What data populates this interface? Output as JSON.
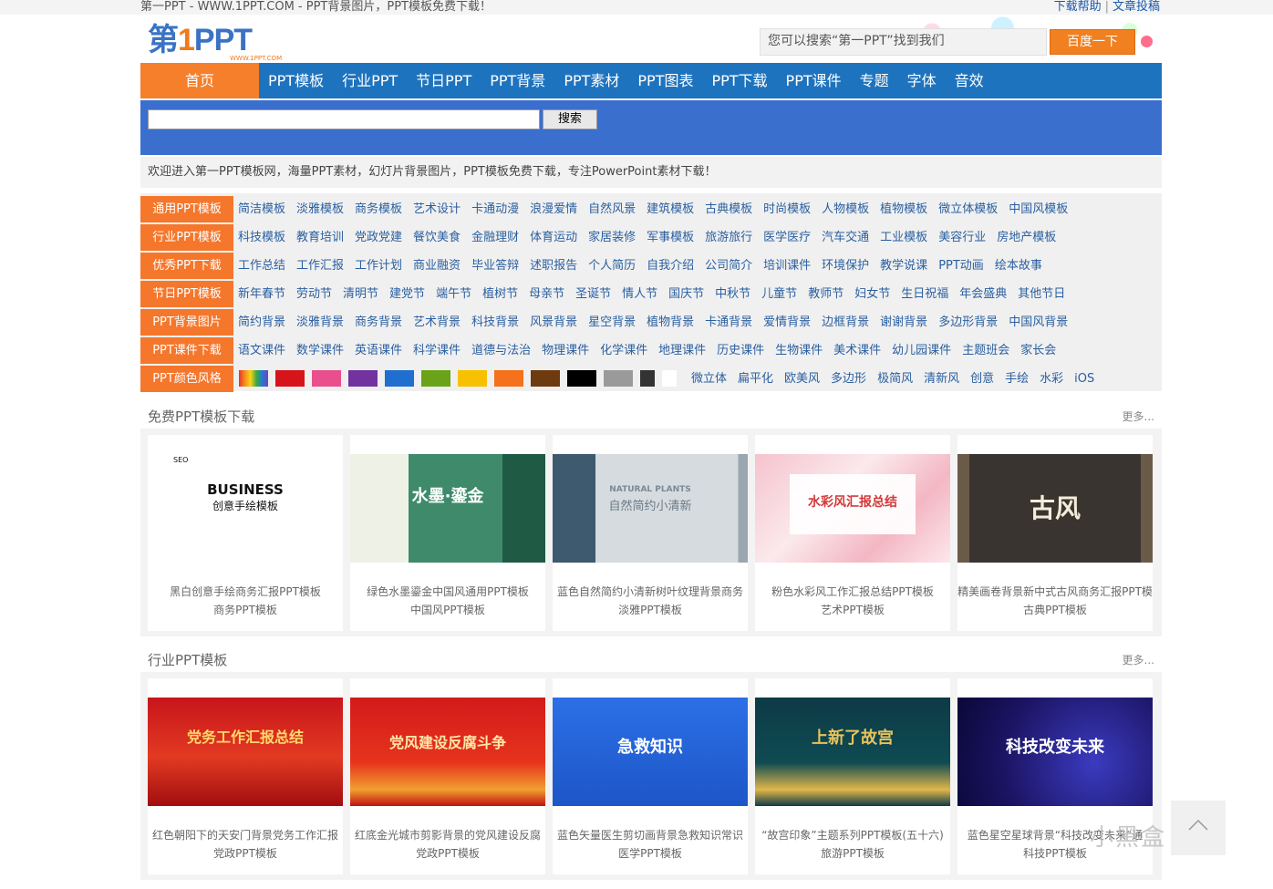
{
  "top": {
    "site_title": "第一PPT - WWW.1PPT.COM - PPT背景图片，PPT模板免费下载！",
    "links": [
      "下载帮助",
      "文章投稿"
    ]
  },
  "logo": {
    "text_a": "第",
    "text_num": "1",
    "text_b": "PPT",
    "sub": "WWW.1PPT.COM"
  },
  "search": {
    "placeholder": "您可以搜索“第一PPT”找到我们",
    "button": "百度一下"
  },
  "nav": {
    "home": "首页",
    "items": [
      "PPT模板",
      "行业PPT",
      "节日PPT",
      "PPT背景",
      "PPT素材",
      "PPT图表",
      "PPT下载",
      "PPT课件",
      "专题",
      "字体",
      "音效"
    ]
  },
  "site_search": {
    "button": "搜索"
  },
  "welcome": "欢迎进入第一PPT模板网，海量PPT素材，幻灯片背景图片，PPT模板免费下载，专注PowerPoint素材下载！",
  "categories": [
    {
      "label": "通用PPT模板",
      "links": [
        "简洁模板",
        "淡雅模板",
        "商务模板",
        "艺术设计",
        "卡通动漫",
        "浪漫爱情",
        "自然风景",
        "建筑模板",
        "古典模板",
        "时尚模板",
        "人物模板",
        "植物模板",
        "微立体模板",
        "中国风模板"
      ]
    },
    {
      "label": "行业PPT模板",
      "links": [
        "科技模板",
        "教育培训",
        "党政党建",
        "餐饮美食",
        "金融理财",
        "体育运动",
        "家居装修",
        "军事模板",
        "旅游旅行",
        "医学医疗",
        "汽车交通",
        "工业模板",
        "美容行业",
        "房地产模板"
      ]
    },
    {
      "label": "优秀PPT下载",
      "links": [
        "工作总结",
        "工作汇报",
        "工作计划",
        "商业融资",
        "毕业答辩",
        "述职报告",
        "个人简历",
        "自我介绍",
        "公司简介",
        "培训课件",
        "环境保护",
        "教学说课",
        "PPT动画",
        "绘本故事"
      ]
    },
    {
      "label": "节日PPT模板",
      "links": [
        "新年春节",
        "劳动节",
        "清明节",
        "建党节",
        "端午节",
        "植树节",
        "母亲节",
        "圣诞节",
        "情人节",
        "国庆节",
        "中秋节",
        "儿童节",
        "教师节",
        "妇女节",
        "生日祝福",
        "年会盛典",
        "其他节日"
      ]
    },
    {
      "label": "PPT背景图片",
      "links": [
        "简约背景",
        "淡雅背景",
        "商务背景",
        "艺术背景",
        "科技背景",
        "风景背景",
        "星空背景",
        "植物背景",
        "卡通背景",
        "爱情背景",
        "边框背景",
        "谢谢背景",
        "多边形背景",
        "中国风背景"
      ]
    },
    {
      "label": "PPT课件下载",
      "links": [
        "语文课件",
        "数学课件",
        "英语课件",
        "科学课件",
        "道德与法治",
        "物理课件",
        "化学课件",
        "地理课件",
        "历史课件",
        "生物课件",
        "美术课件",
        "幼儿园课件",
        "主题班会",
        "家长会"
      ]
    }
  ],
  "colors_row": {
    "label": "PPT颜色风格",
    "swatches": [
      "rainbow",
      "#d7141a",
      "#e84f8c",
      "#7232a0",
      "#1e6fcf",
      "#6aa317",
      "#f8c100",
      "#f5711b",
      "#6e3a0f",
      "#000000",
      "#9a9a9a",
      "#333333",
      "#ffffff"
    ],
    "styles": [
      "微立体",
      "扁平化",
      "欧美风",
      "多边形",
      "极简风",
      "清新风",
      "创意",
      "手绘",
      "水彩",
      "iOS"
    ]
  },
  "sections": [
    {
      "title": "免费PPT模板下载",
      "more": "更多...",
      "cards": [
        {
          "title": "黑白创意手绘商务汇报PPT模板",
          "category": "商务PPT模板",
          "thumb_text": "BUSINESS",
          "thumb_sub": "创意手绘模板",
          "thumb_label_seo": "SEO"
        },
        {
          "title": "绿色水墨鎏金中国风通用PPT模板",
          "category": "中国风PPT模板",
          "thumb_text": "水墨·鎏金"
        },
        {
          "title": "蓝色自然简约小清新树叶纹理背景商务",
          "category": "淡雅PPT模板",
          "thumb_text": "NATURAL PLANTS",
          "thumb_sub": "自然简约小清新"
        },
        {
          "title": "粉色水彩风工作汇报总结PPT模板",
          "category": "艺术PPT模板",
          "thumb_text": "水彩风汇报总结"
        },
        {
          "title": "精美画卷背景新中式古风商务汇报PPT模",
          "category": "古典PPT模板",
          "thumb_text": "古风"
        }
      ]
    },
    {
      "title": "行业PPT模板",
      "more": "更多...",
      "cards": [
        {
          "title": "红色朝阳下的天安门背景党务工作汇报",
          "category": "党政PPT模板",
          "thumb_text": "党务工作汇报总结"
        },
        {
          "title": "红底金光城市剪影背景的党风建设反腐",
          "category": "党政PPT模板",
          "thumb_text": "党风建设反腐斗争"
        },
        {
          "title": "蓝色矢量医生剪切画背景急救知识常识",
          "category": "医学PPT模板",
          "thumb_text": "急救知识"
        },
        {
          "title": "“故宫印象”主题系列PPT模板(五十六)",
          "category": "旅游PPT模板",
          "thumb_text": "上新了故宫"
        },
        {
          "title": "蓝色星空星球背景“科技改变未来”通",
          "category": "科技PPT模板",
          "thumb_text": "科技改变未来"
        }
      ]
    }
  ],
  "watermark": "小黑盒"
}
